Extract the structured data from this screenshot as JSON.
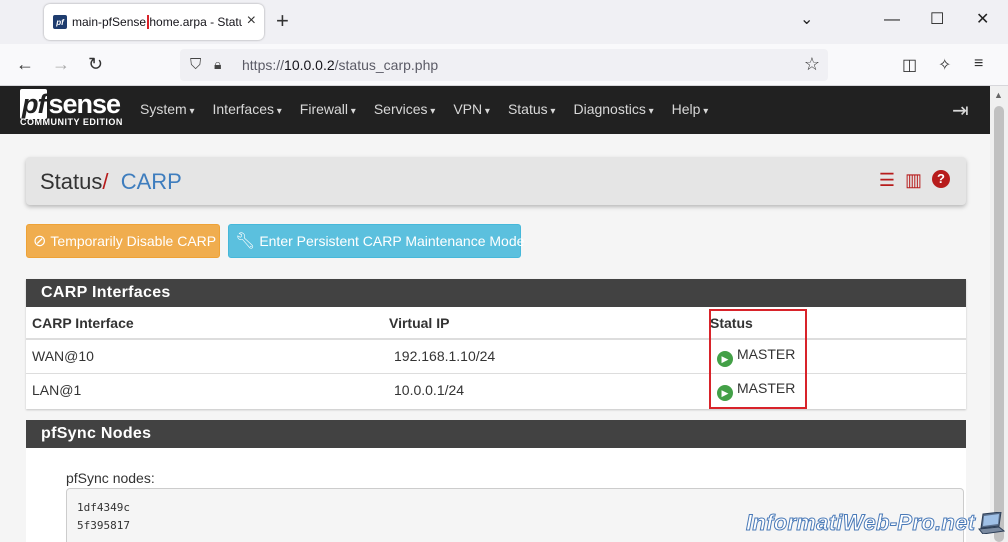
{
  "browser": {
    "tab_title_highlight": "main-pfSense",
    "tab_title_rest": ".home.arpa - Status: CARP",
    "url_prefix": "https://",
    "url_host": "10.0.0.2",
    "url_path": "/status_carp.php"
  },
  "logo": {
    "pf": "pf",
    "sense": "sense",
    "edition": "COMMUNITY EDITION"
  },
  "menu": {
    "items": [
      "System",
      "Interfaces",
      "Firewall",
      "Services",
      "VPN",
      "Status",
      "Diagnostics",
      "Help"
    ]
  },
  "breadcrumb": {
    "parent": "Status",
    "separator": "/",
    "current": "CARP"
  },
  "buttons": {
    "disable_carp": "Temporarily Disable CARP",
    "maintenance": "Enter Persistent CARP Maintenance Mode"
  },
  "carp_panel": {
    "title": "CARP Interfaces",
    "columns": [
      "CARP Interface",
      "Virtual IP",
      "Status"
    ],
    "rows": [
      {
        "interface": "WAN@10",
        "vip": "192.168.1.10/24",
        "status": "MASTER"
      },
      {
        "interface": "LAN@1",
        "vip": "10.0.0.1/24",
        "status": "MASTER"
      }
    ]
  },
  "sync_panel": {
    "title": "pfSync Nodes",
    "label": "pfSync nodes:",
    "nodes": [
      "1df4349c",
      "5f395817"
    ]
  },
  "watermark": "InformatiWeb-Pro.net",
  "colors": {
    "accent_red": "#b71c1c",
    "link_blue": "#3e7dbe",
    "warning": "#f0ad4e",
    "info": "#5bc0de",
    "status_green": "#43a047",
    "highlight_box": "#d8232a"
  }
}
